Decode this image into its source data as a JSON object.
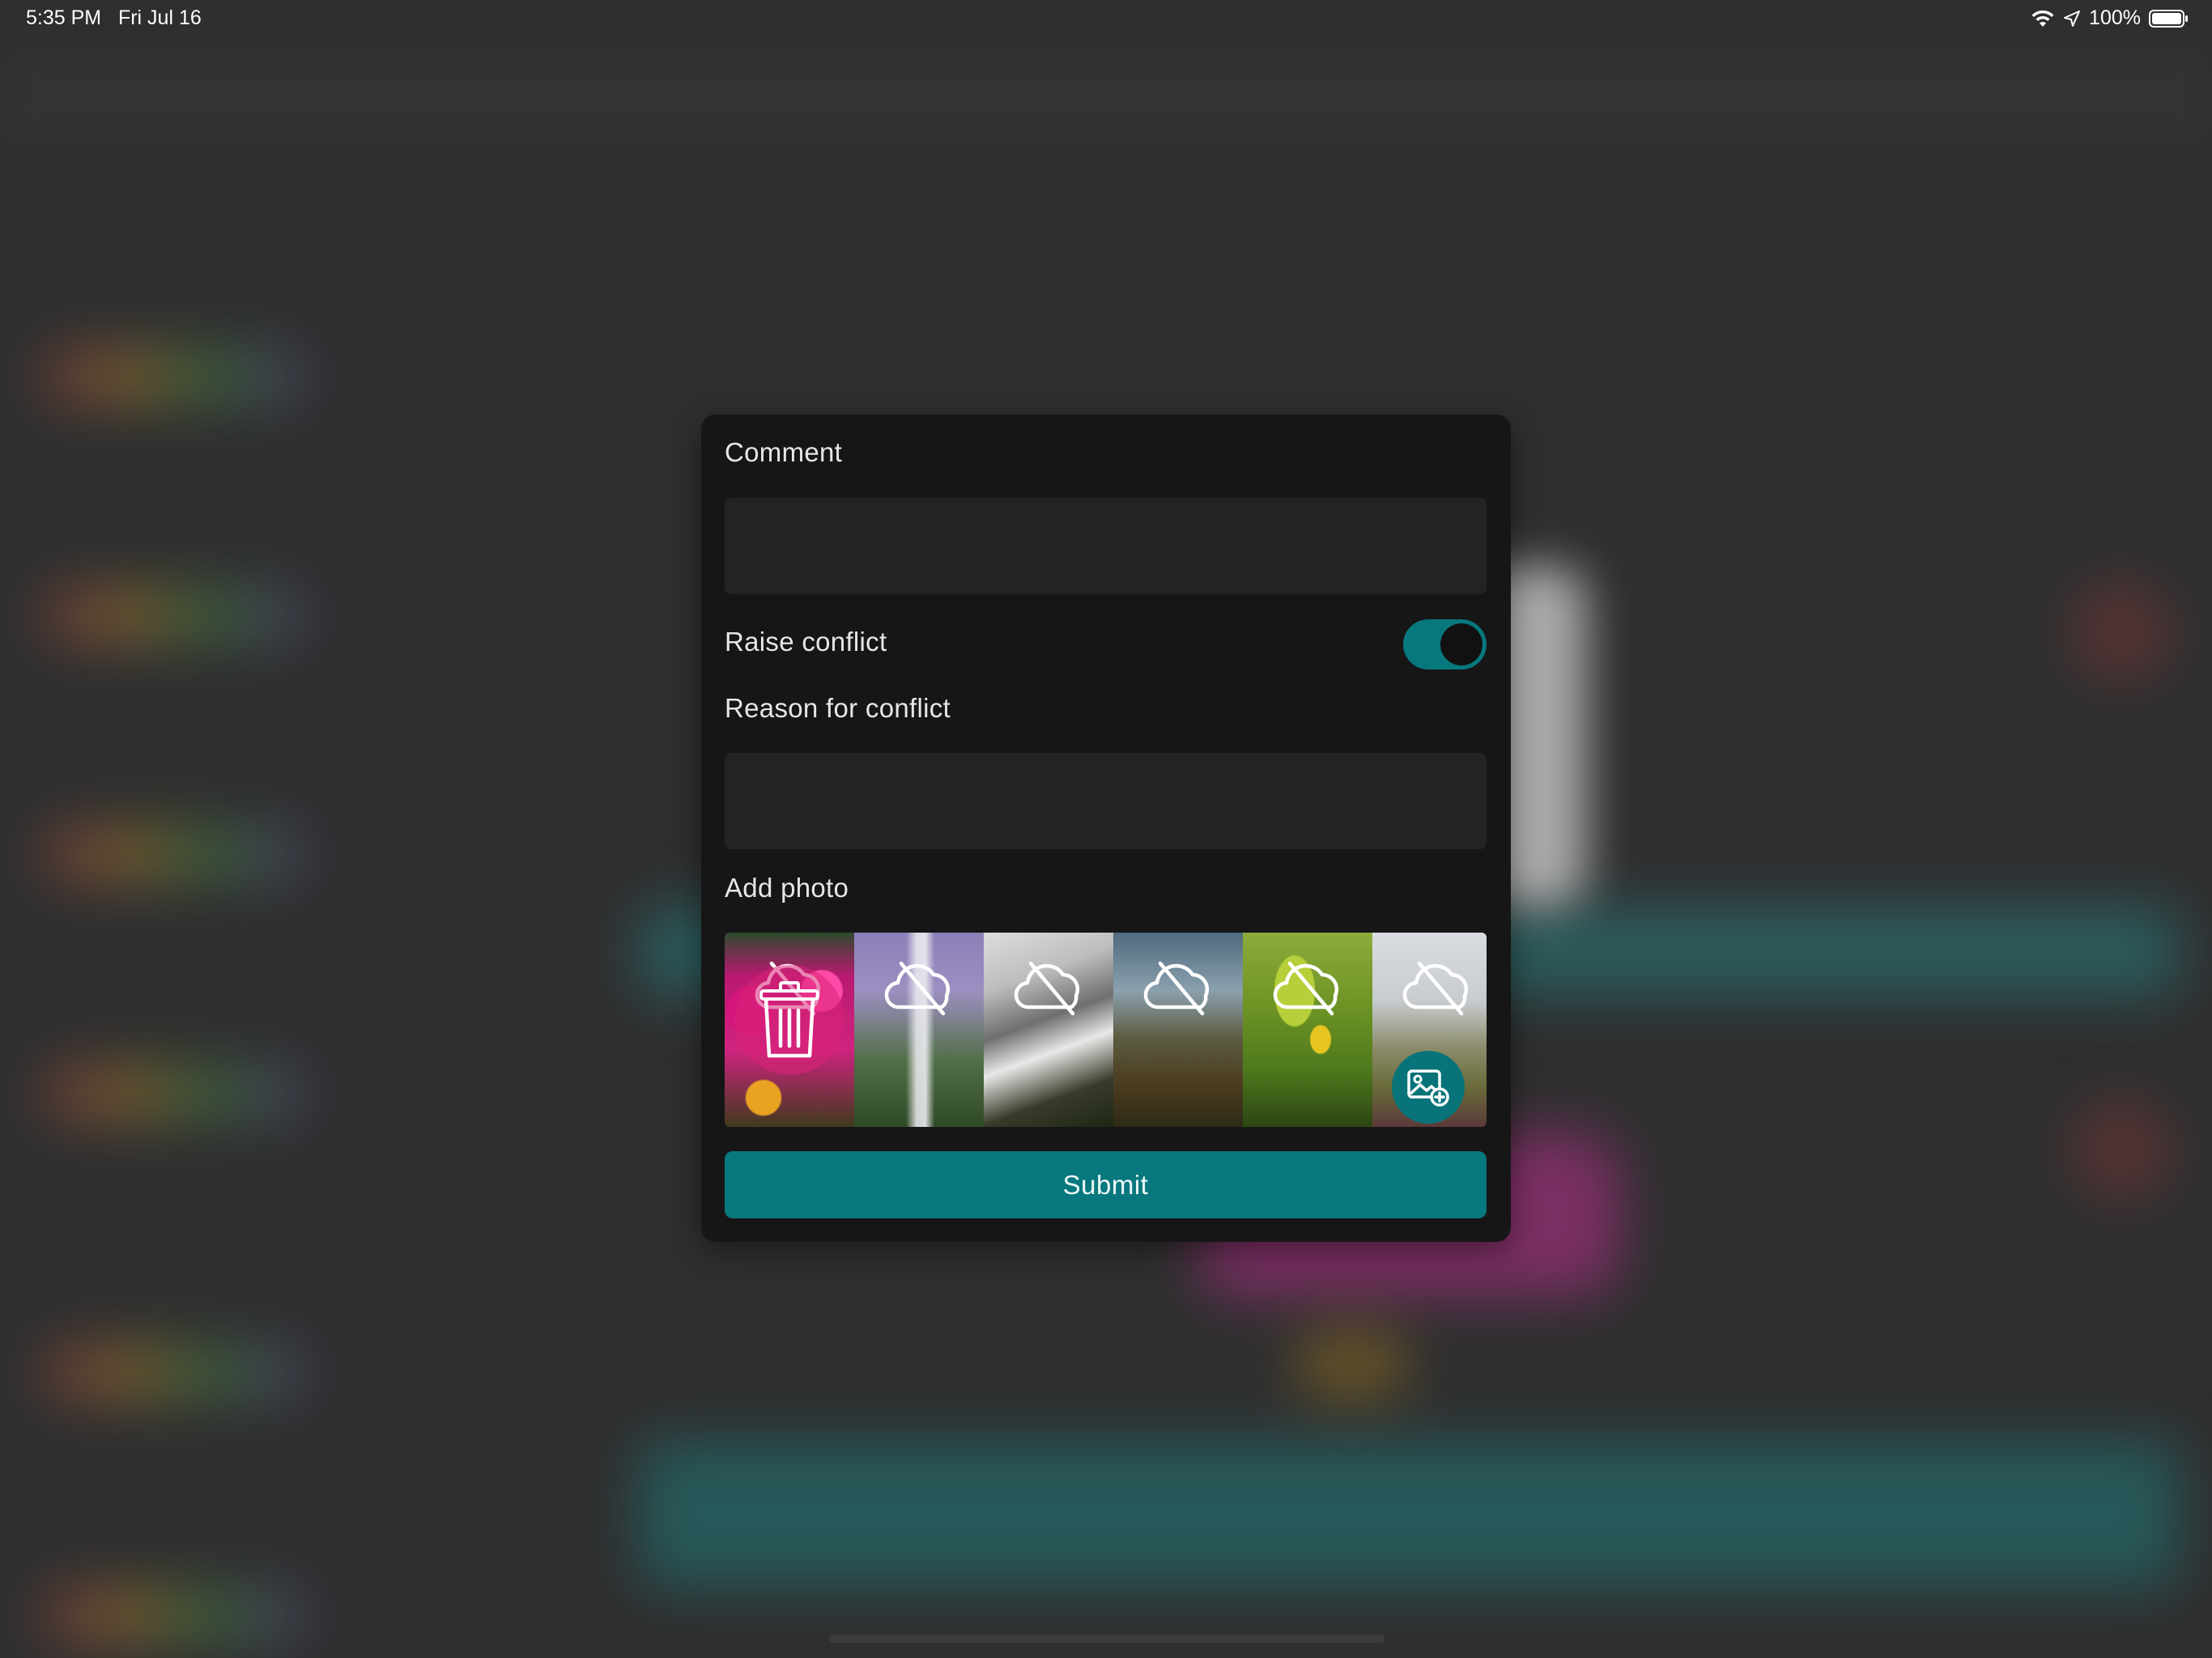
{
  "status_bar": {
    "time": "5:35 PM",
    "date": "Fri Jul 16",
    "battery": "100%",
    "icons": [
      "wifi-icon",
      "location-arrow-icon",
      "battery-icon"
    ]
  },
  "modal": {
    "comment_label": "Comment",
    "comment_value": "",
    "raise_conflict_label": "Raise conflict",
    "raise_conflict_on": true,
    "reason_label": "Reason for conflict",
    "reason_value": "",
    "add_photo_label": "Add photo",
    "photos": [
      {
        "thumb": "pink-flowers",
        "overlay_icon": "cloud-off-icon",
        "selected_for_delete": true
      },
      {
        "thumb": "waterfall-purple-sky",
        "overlay_icon": "cloud-off-icon"
      },
      {
        "thumb": "waterfall-long-exposure",
        "overlay_icon": "cloud-off-icon"
      },
      {
        "thumb": "coastline-rocks",
        "overlay_icon": "cloud-off-icon"
      },
      {
        "thumb": "green-leaves",
        "overlay_icon": "cloud-off-icon"
      },
      {
        "thumb": "meadow-fence",
        "overlay_icon": "cloud-off-icon"
      }
    ],
    "delete_icon": "trash-icon",
    "add_photo_icon": "image-add-icon",
    "submit_label": "Submit"
  },
  "colors": {
    "accent": "#07787d",
    "modal_bg": "#161617",
    "field_bg": "#242224"
  }
}
